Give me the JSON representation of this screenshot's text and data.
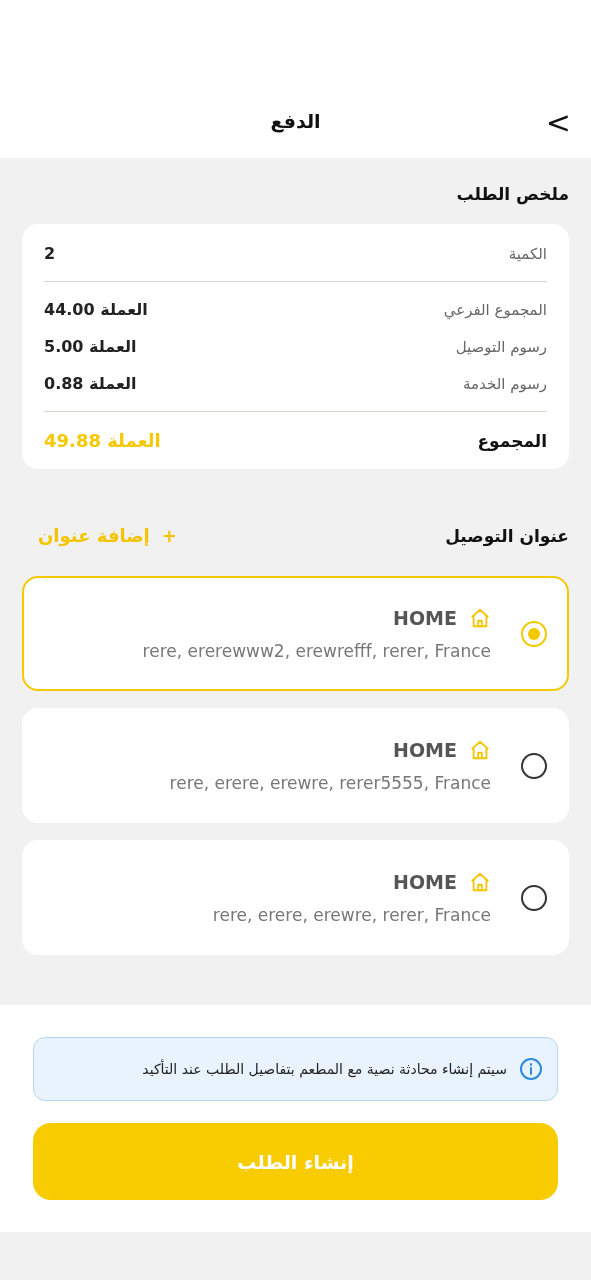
{
  "header": {
    "title": "الدفع",
    "back": ">"
  },
  "order_summary": {
    "title": "ملخص الطلب",
    "quantity": {
      "label": "الكمية",
      "value": "2"
    },
    "lines": [
      {
        "label": "المجموع الفرعي",
        "value": "العملة 44.00"
      },
      {
        "label": "رسوم التوصيل",
        "value": "العملة 5.00"
      },
      {
        "label": "رسوم الخدمة",
        "value": "العملة 0.88"
      }
    ],
    "total": {
      "label": "المجموع",
      "value": "العملة 49.88"
    }
  },
  "delivery": {
    "title": "عنوان التوصيل",
    "add_label": "إضافة عنوان",
    "add_icon": "+",
    "addresses": [
      {
        "name": "HOME",
        "line": "rere, ererewww2, erewrefff, rerer, France",
        "selected": true
      },
      {
        "name": "HOME",
        "line": "rere, erere, erewre, rerer5555, France",
        "selected": false
      },
      {
        "name": "HOME",
        "line": "rere, erere, erewre, rerer, France",
        "selected": false
      }
    ]
  },
  "notice": "سيتم إنشاء محادثة نصية مع المطعم بتفاصيل الطلب عند التأكيد",
  "submit": "إنشاء الطلب"
}
